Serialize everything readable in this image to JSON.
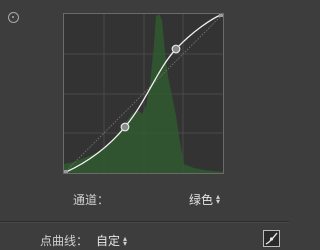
{
  "tone_curve": {
    "channel_label": "通道：",
    "channel_value": "绿色",
    "point_curve_label": "点曲线：",
    "point_curve_value": "自定",
    "curve_color": "#f2f2f2",
    "histogram_color": "#2f5a2f",
    "point_fill": "#8a8a8a",
    "icons": [
      "target-adjust-icon",
      "stepper-arrows-icon",
      "edit-point-curve-icon"
    ]
  }
}
